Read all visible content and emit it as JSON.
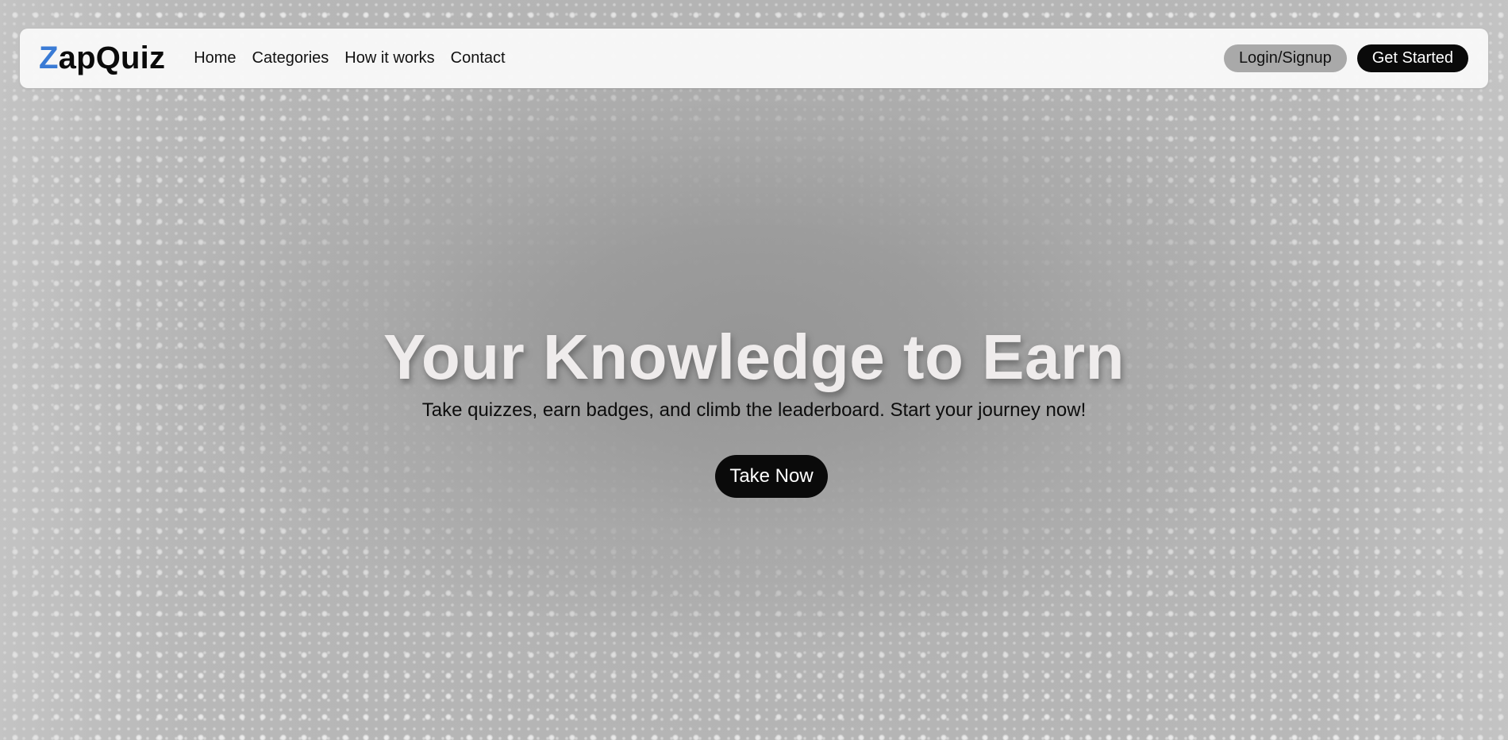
{
  "brand": {
    "logo_first_letter": "Z",
    "logo_rest": "apQuiz",
    "accent_color": "#3a7bd5"
  },
  "nav": {
    "links": [
      "Home",
      "Categories",
      "How it works",
      "Contact"
    ],
    "login_label": "Login/Signup",
    "get_started_label": "Get Started"
  },
  "hero": {
    "title": "Your Knowledge to Earn",
    "subtitle": "Take quizzes, earn badges, and climb the leaderboard. Start your journey now!",
    "cta_label": "Take Now"
  },
  "colors": {
    "button_dark": "#0a0a0a",
    "button_grey": "#a9a9a9",
    "background": "#b8b8b8"
  }
}
